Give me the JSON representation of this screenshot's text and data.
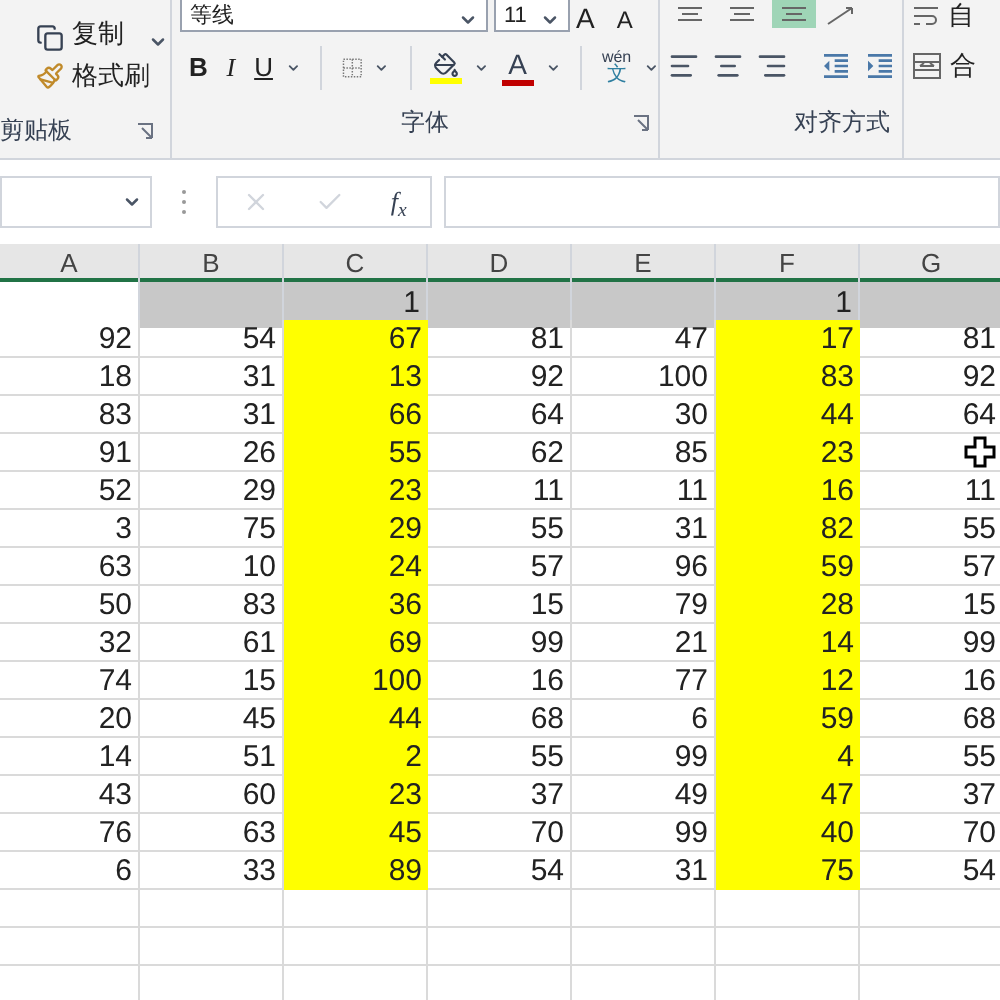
{
  "ribbon": {
    "clipboard": {
      "copy": "复制",
      "format_painter": "格式刷",
      "label": "剪贴板"
    },
    "font": {
      "font_name": "等线",
      "font_size": "11",
      "grow": "A",
      "shrink": "A",
      "bold": "B",
      "italic": "I",
      "underline": "U",
      "font_color": "A",
      "phonetic": "wén",
      "phonetic_char": "文",
      "label": "字体"
    },
    "alignment": {
      "vertical_align": [
        {
          "selected": false
        },
        {
          "selected": false
        },
        {
          "selected": true
        }
      ],
      "label": "对齐方式"
    },
    "wrap_text": "自",
    "merge": "合"
  },
  "formula_bar": {
    "fx": "f$_{x}$"
  },
  "sheet": {
    "columns": [
      {
        "name": "A",
        "highlighted": false
      },
      {
        "name": "B",
        "highlighted": false
      },
      {
        "name": "C",
        "highlighted": true
      },
      {
        "name": "D",
        "highlighted": false
      },
      {
        "name": "E",
        "highlighted": false
      },
      {
        "name": "F",
        "highlighted": true
      },
      {
        "name": "G",
        "highlighted": false
      }
    ],
    "row_1": [
      {
        "shaded": false
      },
      {
        "shaded": true
      },
      {
        "shaded": true,
        "value": "1"
      },
      {
        "shaded": true
      },
      {
        "shaded": true
      },
      {
        "shaded": true,
        "value": "1"
      },
      {
        "shaded": true
      }
    ],
    "rows": [
      [
        "92",
        "54",
        "67",
        "81",
        "47",
        "17",
        "81"
      ],
      [
        "18",
        "31",
        "13",
        "92",
        "100",
        "83",
        "92"
      ],
      [
        "83",
        "31",
        "66",
        "64",
        "30",
        "44",
        "64"
      ],
      [
        "91",
        "26",
        "55",
        "62",
        "85",
        "23",
        null
      ],
      [
        "52",
        "29",
        "23",
        "11",
        "11",
        "16",
        "11"
      ],
      [
        "3",
        "75",
        "29",
        "55",
        "31",
        "82",
        "55"
      ],
      [
        "63",
        "10",
        "24",
        "57",
        "96",
        "59",
        "57"
      ],
      [
        "50",
        "83",
        "36",
        "15",
        "79",
        "28",
        "15"
      ],
      [
        "32",
        "61",
        "69",
        "99",
        "21",
        "14",
        "99"
      ],
      [
        "74",
        "15",
        "100",
        "16",
        "77",
        "12",
        "16"
      ],
      [
        "20",
        "45",
        "44",
        "68",
        "6",
        "59",
        "68"
      ],
      [
        "14",
        "51",
        "2",
        "55",
        "99",
        "4",
        "55"
      ],
      [
        "43",
        "60",
        "23",
        "37",
        "49",
        "47",
        "37"
      ],
      [
        "76",
        "63",
        "45",
        "70",
        "99",
        "40",
        "70"
      ],
      [
        "6",
        "33",
        "89",
        "54",
        "31",
        "75",
        "54"
      ]
    ]
  }
}
